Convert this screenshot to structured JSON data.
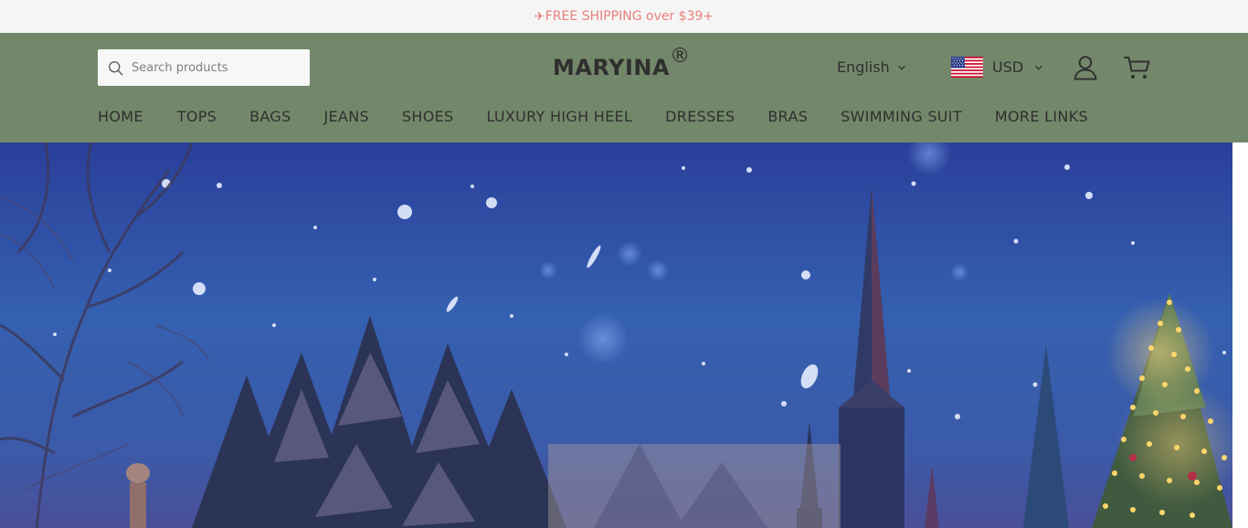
{
  "announcement": {
    "icon": "airplane-icon",
    "text": "FREE SHIPPING over $39+"
  },
  "colors": {
    "announcement_text": "#e8807a",
    "header_bg": "#73886a",
    "text": "#2f2f2f",
    "announcement_bg": "#f5f5f5"
  },
  "search": {
    "placeholder": "Search products",
    "icon": "search-icon"
  },
  "logo": {
    "text": "MARYINA",
    "mark": "®"
  },
  "language": {
    "selected": "English"
  },
  "currency": {
    "selected": "USD",
    "flag": "us-flag-icon"
  },
  "icons": {
    "account": "user-icon",
    "cart": "cart-icon"
  },
  "nav": {
    "items": [
      "HOME",
      "TOPS",
      "BAGS",
      "JEANS",
      "SHOES",
      "LUXURY HIGH HEEL",
      "DRESSES",
      "BRAS",
      "SWIMMING SUIT",
      "MORE LINKS"
    ]
  }
}
